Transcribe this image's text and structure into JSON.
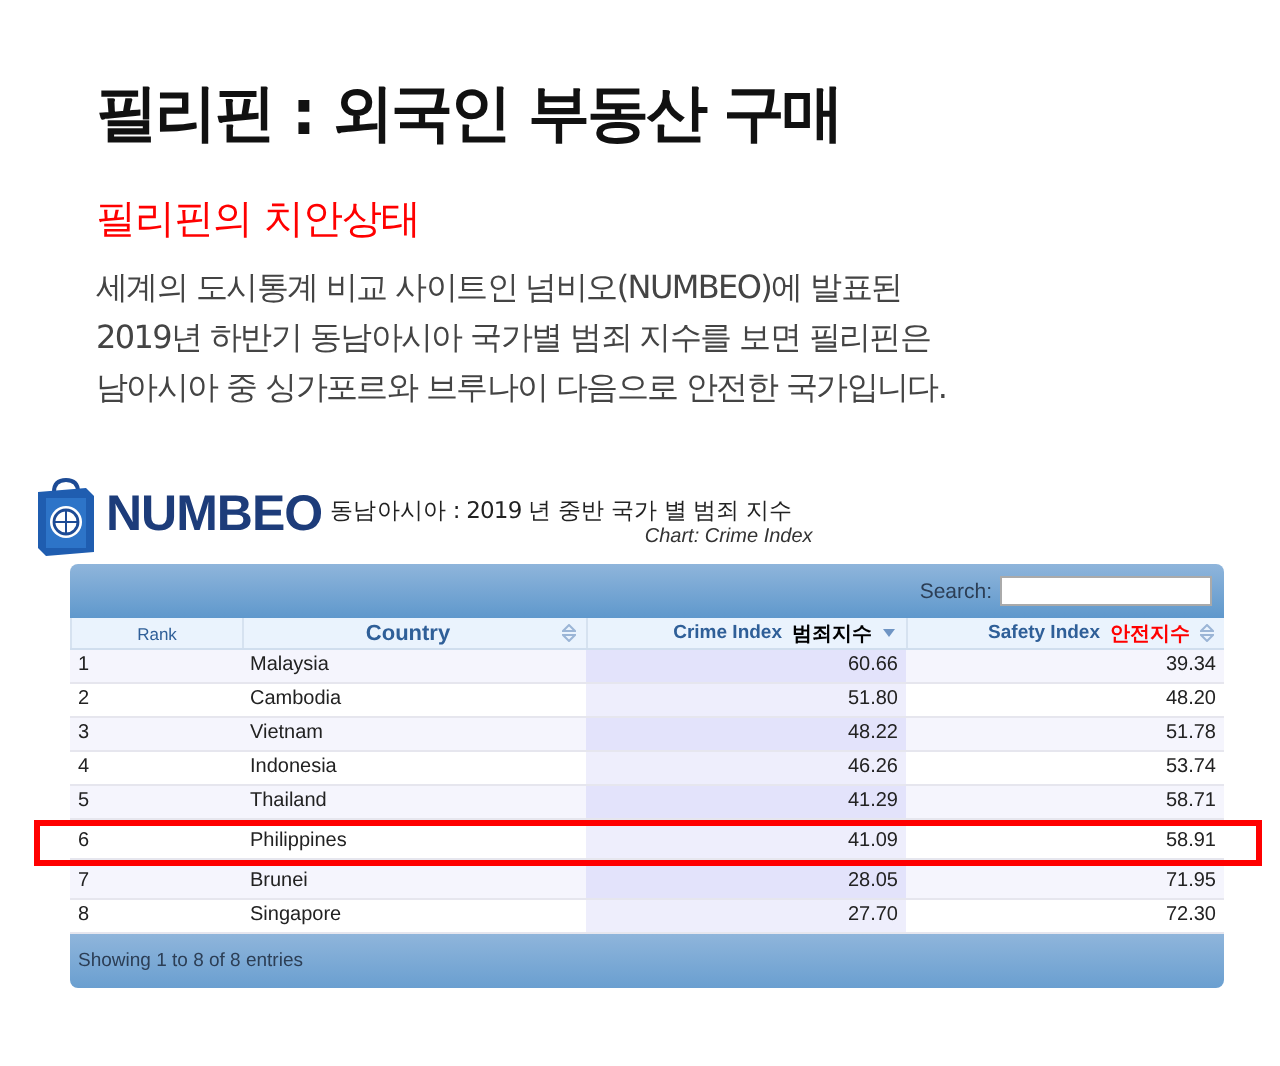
{
  "title": "필리핀 : 외국인 부동산 구매",
  "subtitle": "필리핀의 치안상태",
  "paragraph": "세계의 도시통계 비교 사이트인 넘비오(NUMBEO)에 발표된 2019년 하반기 동남아시아 국가별 범죄 지수를 보면 필리핀은 남아시아 중 싱가포르와 브루나이 다음으로 안전한 국가입니다.",
  "figure": {
    "brand": "NUMBEO",
    "heading": "동남아시아 : 2019 년 중반 국가 별 범죄 지수",
    "chart_label": "Chart: Crime Index",
    "search": {
      "label": "Search:"
    },
    "columns": [
      {
        "label": "Rank",
        "kind": "plain"
      },
      {
        "label": "Country",
        "kind": "sortable"
      },
      {
        "label": "Crime Index",
        "annotation": "범죄지수",
        "color": "#000000",
        "kind": "sorted"
      },
      {
        "label": "Safety Index",
        "annotation": "안전지수",
        "color": "#ff0000",
        "kind": "sortable"
      }
    ],
    "rows": [
      {
        "cells": [
          "1",
          "Malaysia",
          "60.66",
          "39.34"
        ],
        "highlighted": false
      },
      {
        "cells": [
          "2",
          "Cambodia",
          "51.80",
          "48.20"
        ],
        "highlighted": false
      },
      {
        "cells": [
          "3",
          "Vietnam",
          "48.22",
          "51.78"
        ],
        "highlighted": false
      },
      {
        "cells": [
          "4",
          "Indonesia",
          "46.26",
          "53.74"
        ],
        "highlighted": false
      },
      {
        "cells": [
          "5",
          "Thailand",
          "41.29",
          "58.71"
        ],
        "highlighted": false
      },
      {
        "cells": [
          "6",
          "Philippines",
          "41.09",
          "58.91"
        ],
        "highlighted": true
      },
      {
        "cells": [
          "7",
          "Brunei",
          "28.05",
          "71.95"
        ],
        "highlighted": false
      },
      {
        "cells": [
          "8",
          "Singapore",
          "27.70",
          "72.30"
        ],
        "highlighted": false
      }
    ],
    "footer": "Showing 1 to 8 of 8 entries"
  }
}
